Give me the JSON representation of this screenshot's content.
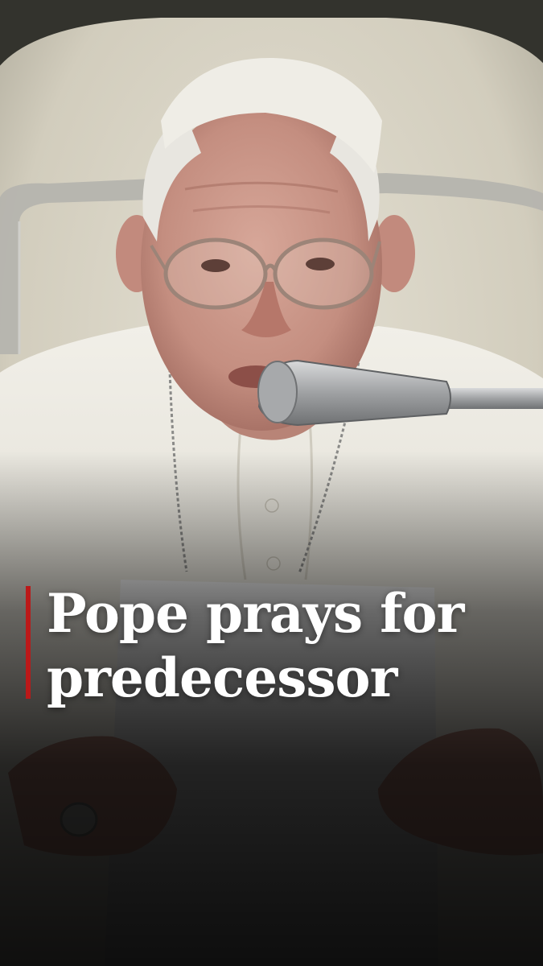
{
  "photo": {
    "subject": "pope-speaking-at-microphone",
    "palette": {
      "chair": "#d9d4c6",
      "chair_trim": "#b8b7b2",
      "backdrop": "#3a3a34",
      "skin": "#c9988a",
      "cassock": "#e6e4dc",
      "paper": "#efefef",
      "microphone": "#a9abad"
    }
  },
  "headline": {
    "accent_color": "#bb1919",
    "line_1": "Pope prays for",
    "line_2": "predecessor"
  }
}
